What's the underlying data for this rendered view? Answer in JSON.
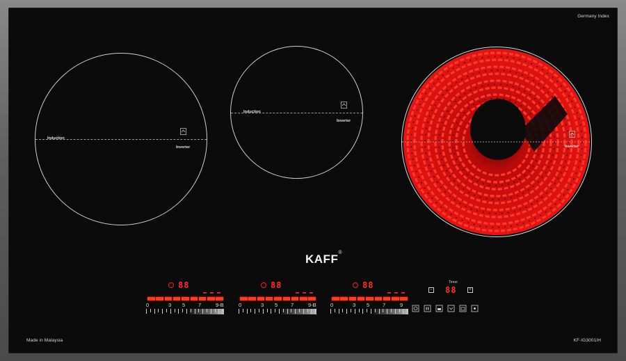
{
  "product": {
    "brand": "KAFF",
    "brand_mark": "®",
    "origin_tag": "Germany Index",
    "made_in": "Made in Malaysia",
    "model": "KF-IG3001IH"
  },
  "zones": [
    {
      "label_left": "Induction",
      "label_right": "Inverter",
      "heating": false
    },
    {
      "label_left": "Induction",
      "label_right": "Inverter",
      "heating": false
    },
    {
      "label_left": "",
      "label_right": "Inverter",
      "heating": true
    }
  ],
  "zone_controls": [
    {
      "timer_display": "88",
      "scale_labels": [
        "0",
        "3",
        "5",
        "7",
        "9-B"
      ],
      "power_level": 9
    },
    {
      "timer_display": "88",
      "scale_labels": [
        "0",
        "3",
        "5",
        "7",
        "9-B"
      ],
      "power_level": 9
    },
    {
      "timer_display": "88",
      "scale_labels": [
        "0",
        "3",
        "5",
        "7",
        "9"
      ],
      "power_level": 9
    }
  ],
  "timer_panel": {
    "title": "Timer",
    "display": "88",
    "minus_label": "−",
    "plus_label": "+"
  },
  "function_icons": [
    "power-icon",
    "pause-icon",
    "lock-icon",
    "boost-icon",
    "keep-warm-icon",
    "pan-detect-icon"
  ],
  "colors": {
    "glass": "#0b0b0b",
    "indicator_red": "#ff2a2a",
    "heating_red": "#e31212"
  }
}
